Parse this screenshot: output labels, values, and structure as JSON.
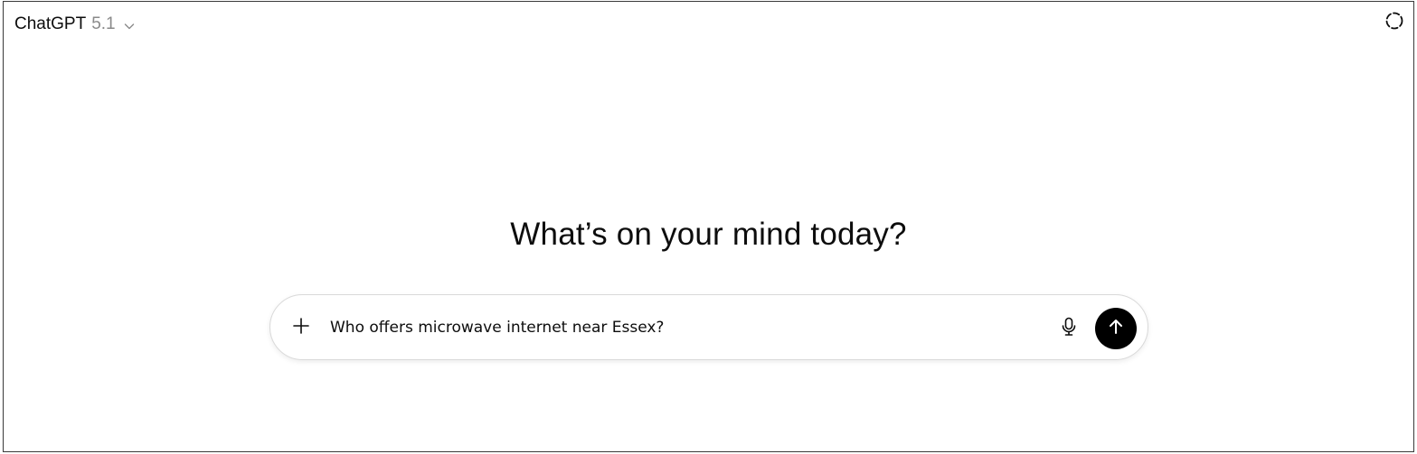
{
  "header": {
    "model_name": "ChatGPT",
    "model_version": "5.1",
    "model_menu_icon": "chevron-down-icon",
    "temporary_chat_icon": "dashed-circle-icon"
  },
  "main": {
    "headline": "What’s on your mind today?"
  },
  "composer": {
    "attach_icon": "plus-icon",
    "input_value": "Who offers microwave internet near Essex?",
    "mic_icon": "microphone-icon",
    "send_icon": "arrow-up-icon"
  },
  "colors": {
    "text": "#0d0d0d",
    "muted": "#8a8a8a",
    "send_button": "#000000",
    "composer_border": "#d9d9d9"
  }
}
